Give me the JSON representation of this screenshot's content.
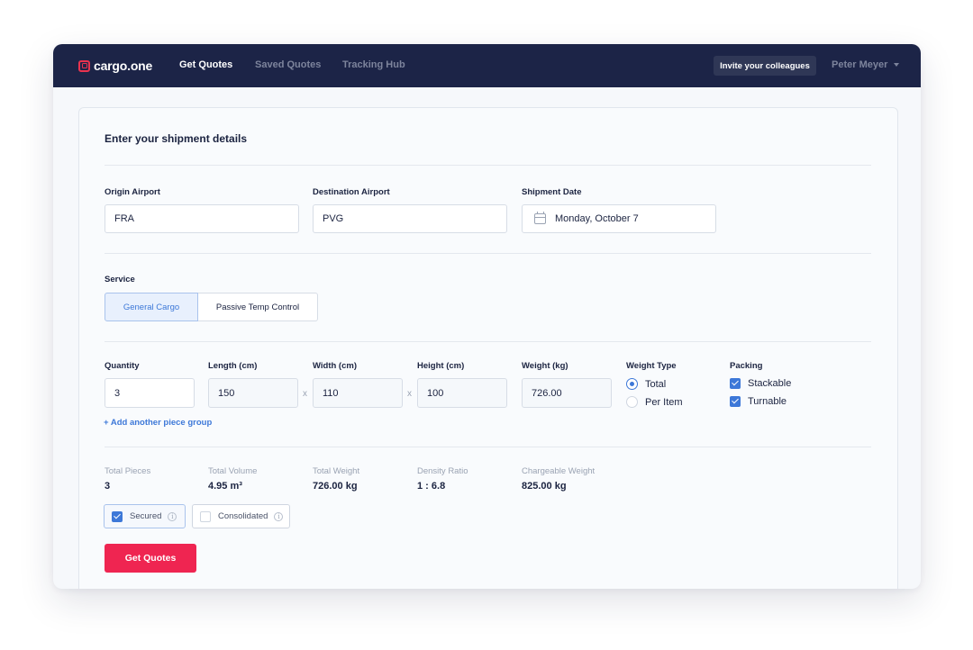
{
  "app": {
    "brand": "cargo.one",
    "accent": "#ef2551",
    "nav_bg": "#1c2447"
  },
  "nav": {
    "links": [
      "Get Quotes",
      "Saved Quotes",
      "Tracking Hub"
    ],
    "active": "Get Quotes",
    "invite_label": "Invite your colleagues",
    "user_name": "Peter Meyer"
  },
  "form": {
    "title": "Enter your shipment details",
    "origin": {
      "label": "Origin Airport",
      "value": "FRA"
    },
    "destination": {
      "label": "Destination Airport",
      "value": "PVG"
    },
    "date": {
      "label": "Shipment Date",
      "value": "Monday, October 7",
      "icon": "calendar-icon"
    },
    "service": {
      "label": "Service",
      "options": [
        "General Cargo",
        "Passive Temp Control"
      ],
      "selected": "General Cargo"
    },
    "pieces": {
      "quantity": {
        "label": "Quantity",
        "value": "3"
      },
      "length": {
        "label": "Length (cm)",
        "value": "150"
      },
      "width": {
        "label": "Width (cm)",
        "value": "110"
      },
      "height": {
        "label": "Height (cm)",
        "value": "100"
      },
      "weight": {
        "label": "Weight (kg)",
        "value": "726.00"
      },
      "separator": "x"
    },
    "weight_type": {
      "label": "Weight Type",
      "options": [
        "Total",
        "Per Item"
      ],
      "selected": "Total"
    },
    "packing": {
      "label": "Packing",
      "options": [
        {
          "label": "Stackable",
          "checked": true
        },
        {
          "label": "Turnable",
          "checked": true
        }
      ]
    },
    "add_piece_label": "+ Add another piece group"
  },
  "summary": {
    "items": [
      {
        "label": "Total Pieces",
        "value": "3"
      },
      {
        "label": "Total Volume",
        "value": "4.95 m³"
      },
      {
        "label": "Total Weight",
        "value": "726.00 kg"
      },
      {
        "label": "Density Ratio",
        "value": "1 : 6.8"
      },
      {
        "label": "Chargeable Weight",
        "value": "825.00 kg"
      }
    ]
  },
  "options": [
    {
      "label": "Secured",
      "checked": true,
      "info": "i"
    },
    {
      "label": "Consolidated",
      "checked": false,
      "info": "i"
    }
  ],
  "cta_label": "Get Quotes"
}
